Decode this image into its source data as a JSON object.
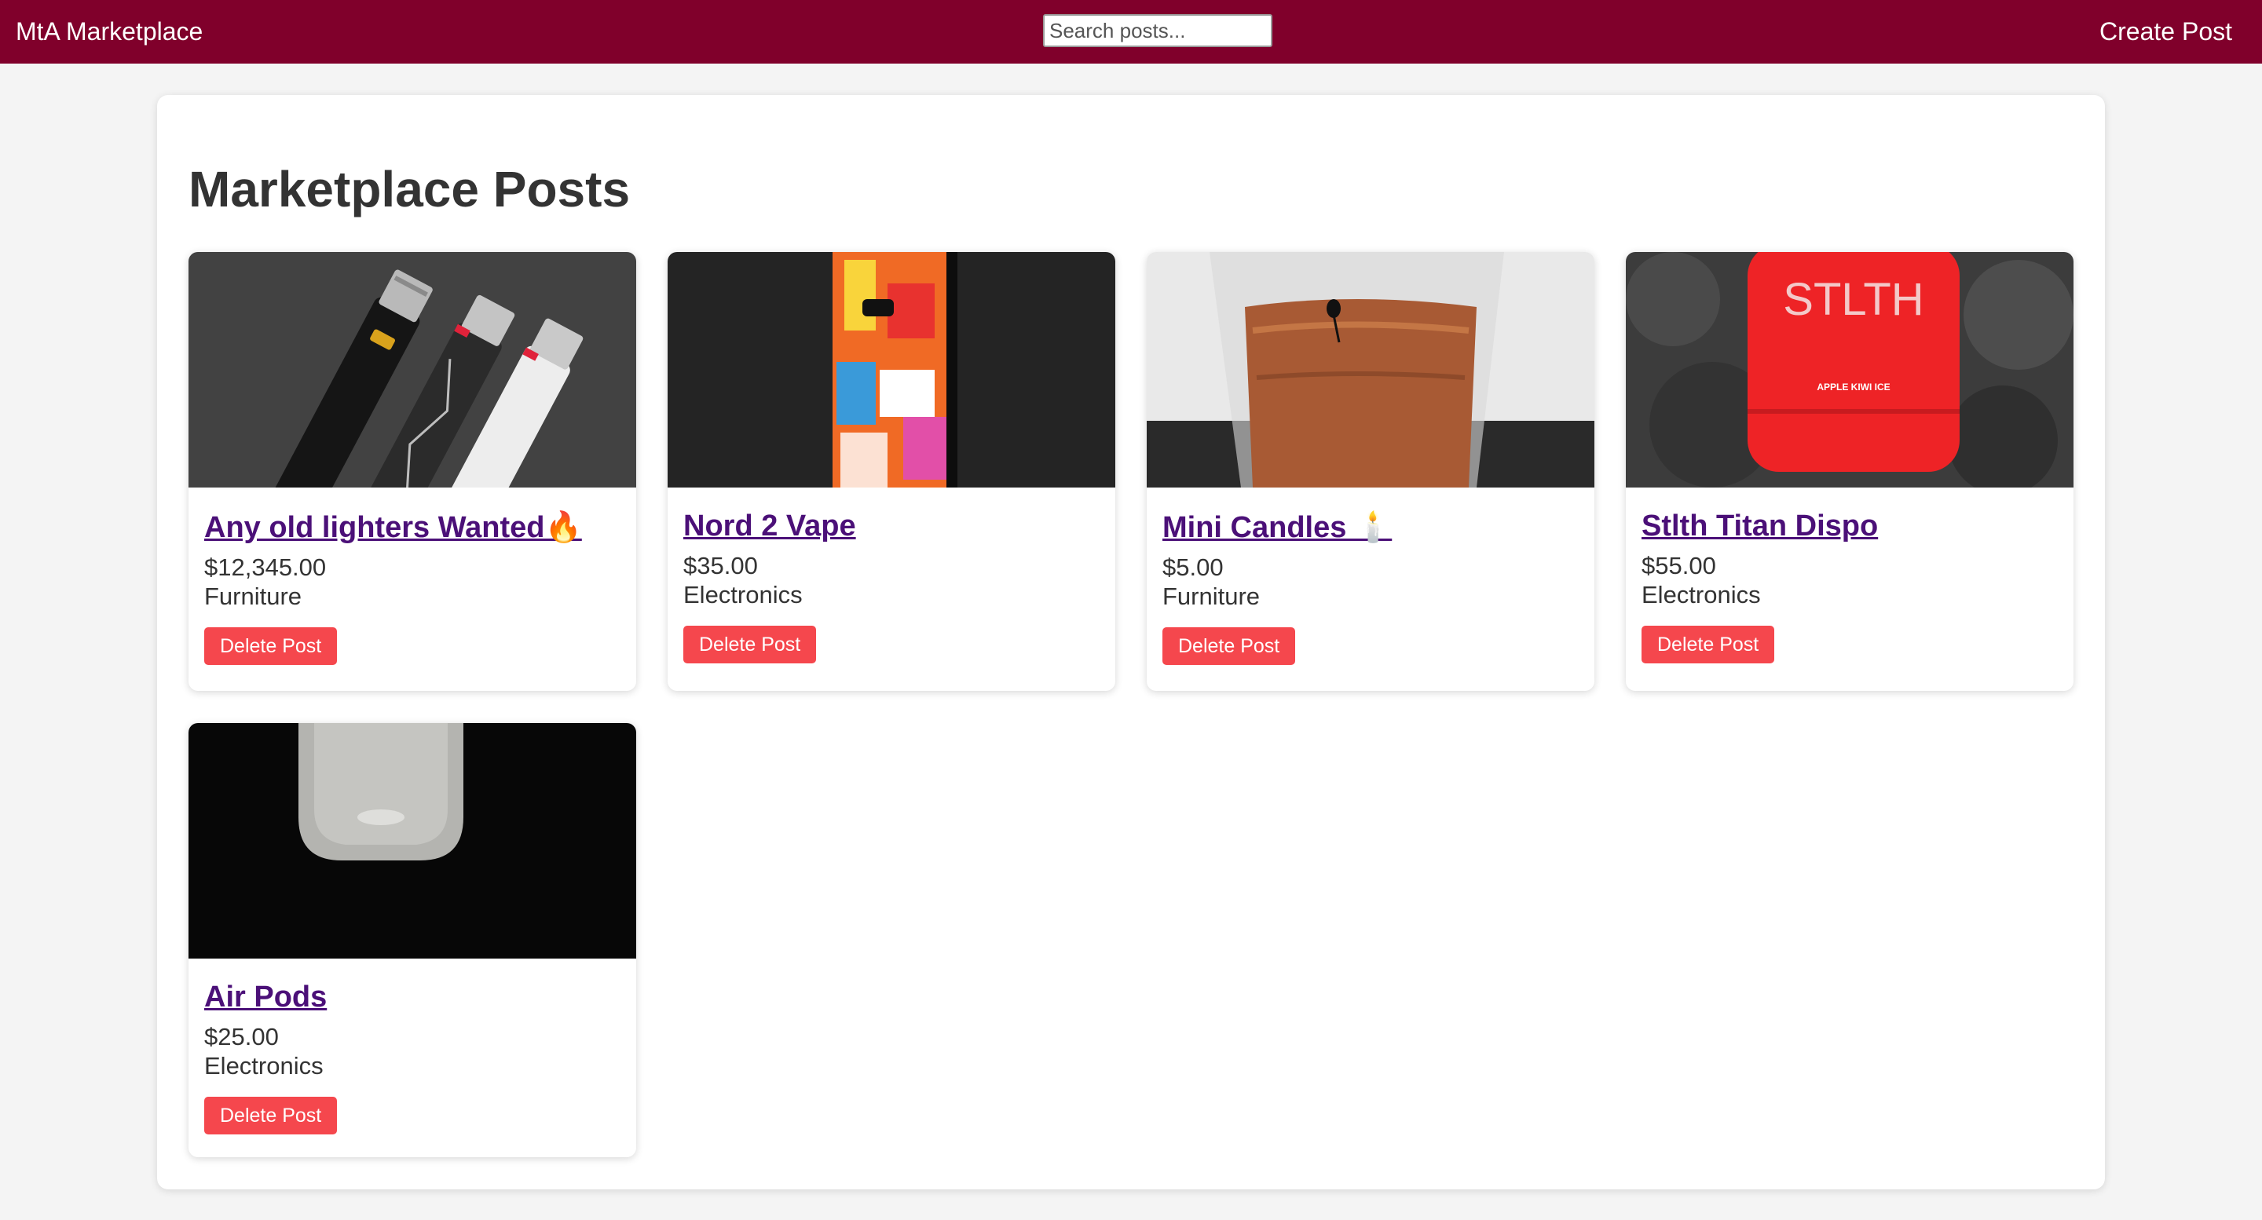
{
  "navbar": {
    "brand": "MtA Marketplace",
    "search_placeholder": "Search posts...",
    "search_value": "",
    "create_label": "Create Post",
    "color": "#80002b"
  },
  "page_title": "Marketplace Posts",
  "delete_color": "#f5474d",
  "posts": [
    {
      "title": "Any old lighters Wanted🔥",
      "price": "$12,345.00",
      "category": "Furniture",
      "delete_label": "Delete Post",
      "image": "lighters-photo"
    },
    {
      "title": "Nord 2 Vape",
      "price": "$35.00",
      "category": "Electronics",
      "delete_label": "Delete Post",
      "image": "vape-photo"
    },
    {
      "title": "Mini Candles 🕯️",
      "price": "$5.00",
      "category": "Furniture",
      "delete_label": "Delete Post",
      "image": "candle-photo"
    },
    {
      "title": "Stlth Titan Dispo",
      "price": "$55.00",
      "category": "Electronics",
      "delete_label": "Delete Post",
      "image": "stlth-device-photo",
      "image_text": {
        "brand": "STLTH",
        "flavor": "APPLE KIWI ICE"
      }
    },
    {
      "title": "Air Pods",
      "price": "$25.00",
      "category": "Electronics",
      "delete_label": "Delete Post",
      "image": "airpods-case-photo"
    }
  ]
}
